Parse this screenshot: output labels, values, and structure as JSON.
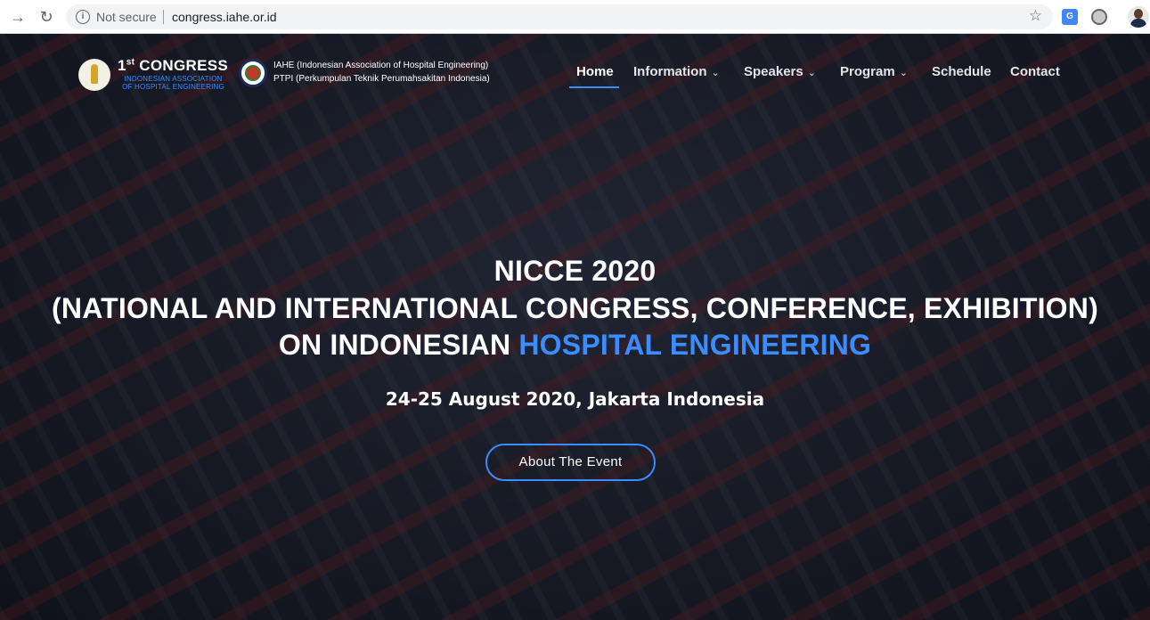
{
  "browser": {
    "back_icon": "back-arrow-icon",
    "reload_icon": "reload-icon",
    "security_label": "Not secure",
    "url": "congress.iahe.or.id"
  },
  "header": {
    "brand_title_prefix": "1",
    "brand_title_sup": "st",
    "brand_title_suffix": " CONGRESS",
    "brand_subtitle_line1": "INDONESIAN ASSOCIATION",
    "brand_subtitle_line2": "OF HOSPITAL ENGINEERING",
    "org_line1": "IAHE (Indonesian Association of Hospital Engineering)",
    "org_line2": "PTPI (Perkumpulan Teknik Perumahsakitan Indonesia)"
  },
  "nav": {
    "items": [
      {
        "label": "Home",
        "active": true
      },
      {
        "label": "Information",
        "dropdown": true
      },
      {
        "label": "Speakers",
        "dropdown": true
      },
      {
        "label": "Program",
        "dropdown": true
      },
      {
        "label": "Schedule"
      },
      {
        "label": "Contact"
      }
    ],
    "caret": "⌄"
  },
  "hero": {
    "title_line1": "NICCE 2020",
    "title_line2": "(NATIONAL AND INTERNATIONAL CONGRESS, CONFERENCE, EXHIBITION)",
    "title_line3_prefix": "ON INDONESIAN ",
    "title_line3_accent": "HOSPITAL ENGINEERING",
    "date": "24-25 August 2020, Jakarta Indonesia",
    "cta": "About The Event"
  },
  "colors": {
    "accent": "#3b8cff",
    "text": "#ffffff"
  }
}
